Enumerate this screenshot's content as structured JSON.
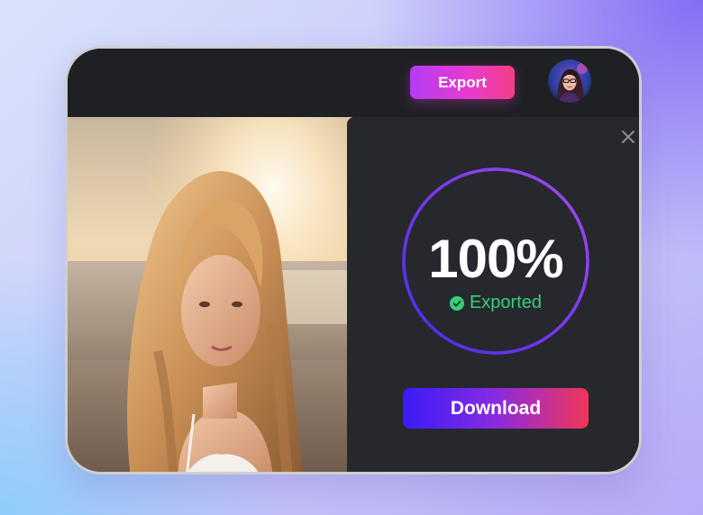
{
  "toolbar": {
    "export_label": "Export"
  },
  "export_dialog": {
    "progress_percent": 100,
    "progress_text": "100%",
    "status_text": "Exported",
    "download_label": "Download"
  },
  "icons": {
    "close": "close-icon",
    "check": "check-circle-icon",
    "avatar": "user-avatar"
  },
  "colors": {
    "export_gradient": [
      "#b43cf4",
      "#f43f86"
    ],
    "ring_gradient": [
      "#4a2be8",
      "#a24af2"
    ],
    "download_gradient": [
      "#3a1cf7",
      "#f23558"
    ],
    "success": "#35d07a"
  }
}
